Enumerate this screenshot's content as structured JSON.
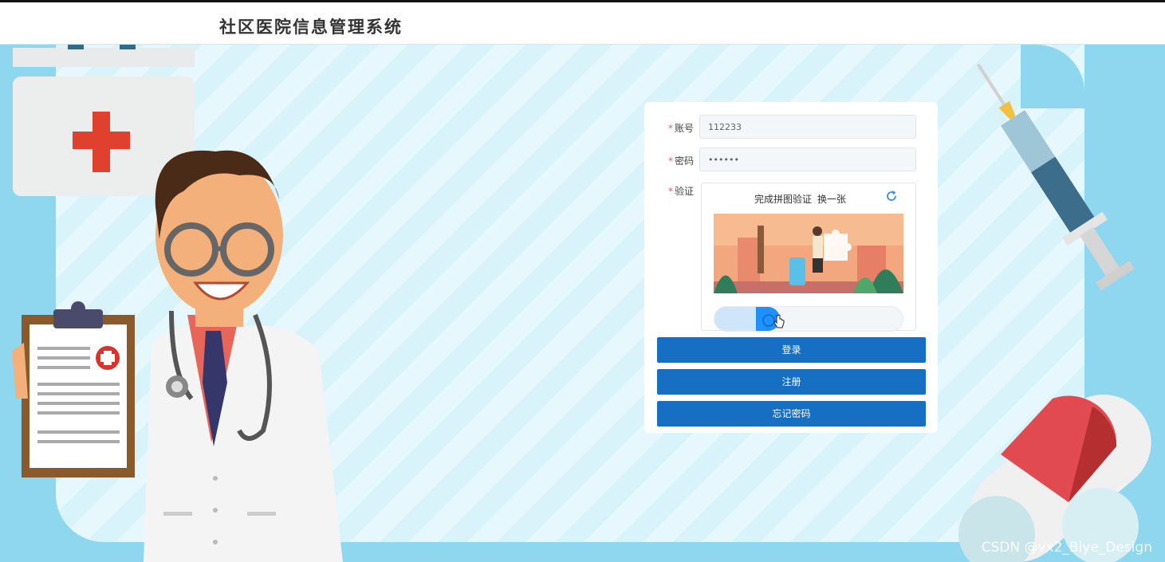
{
  "header": {
    "title": "社区医院信息管理系统"
  },
  "form": {
    "account_label": "账号",
    "account_value": "112233",
    "password_label": "密码",
    "password_value": "••••••",
    "verify_label": "验证",
    "required_mark": "*"
  },
  "captcha": {
    "prompt": "完成拼图验证",
    "change_link": "换一张",
    "slider_progress": 0.25
  },
  "buttons": {
    "login": "登录",
    "register": "注册",
    "forgot": "忘记密码"
  },
  "watermark": "CSDN @vx2_Biye_Design",
  "colors": {
    "primary_button": "#176fc4",
    "slider_handle": "#1e90ff",
    "background": "#8fd6ef"
  }
}
